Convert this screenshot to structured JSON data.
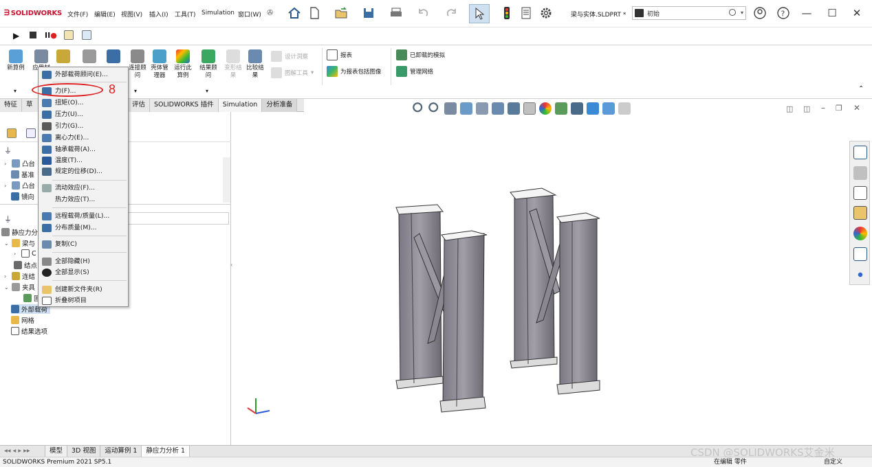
{
  "app": {
    "brand": "SOLIDWORKS",
    "doc_title": "梁与实体.SLDPRT *",
    "search_placeholder": "初始"
  },
  "menubar": [
    "文件(F)",
    "编辑(E)",
    "视图(V)",
    "插入(I)",
    "工具(T)",
    "Simulation",
    "窗口(W)"
  ],
  "ribbon": {
    "big": [
      {
        "label": "新算例",
        "icon": "new-study-icon"
      },
      {
        "label": "应用材",
        "icon": "apply-material-icon"
      },
      {
        "label": "结果顾\n问",
        "icon": "results-advisor-icon"
      },
      {
        "label": "变形结\n果",
        "icon": "deformed-result-icon",
        "disabled": true
      },
      {
        "label": "比较结\n果",
        "icon": "compare-results-icon"
      },
      {
        "label": "连接顾\n问",
        "icon": "connections-advisor-icon"
      },
      {
        "label": "壳体管\n理器",
        "icon": "shell-manager-icon"
      },
      {
        "label": "运行此\n算例",
        "icon": "run-study-icon"
      }
    ],
    "small": [
      "设计洞察",
      "图解工具",
      "报表",
      "为报表包括图像",
      "已卸载的模拟",
      "管理网络"
    ],
    "partial": [
      "传",
      "夹具顾",
      "外部载",
      "荷"
    ]
  },
  "tabs": [
    "特征",
    "草",
    "",
    "",
    "评估",
    "SOLIDWORKS 插件",
    "Simulation",
    "分析准备"
  ],
  "context_menu": {
    "items": [
      {
        "label": "外部载荷顾问(E)...",
        "icon": "load-advisor-icon"
      },
      {
        "label": "力(F)...",
        "icon": "force-icon"
      },
      {
        "label": "扭矩(O)...",
        "icon": "torque-icon"
      },
      {
        "label": "压力(U)...",
        "icon": "pressure-icon"
      },
      {
        "label": "引力(G)...",
        "icon": "gravity-icon"
      },
      {
        "label": "离心力(E)...",
        "icon": "centrifugal-icon"
      },
      {
        "label": "轴承载荷(A)...",
        "icon": "bearing-load-icon"
      },
      {
        "label": "温度(T)...",
        "icon": "temperature-icon"
      },
      {
        "label": "规定的位移(D)...",
        "icon": "displacement-icon"
      },
      {
        "label": "流动效应(F)...",
        "icon": "flow-icon"
      },
      {
        "label": "热力效应(T)...",
        "icon": "thermal-icon"
      },
      {
        "label": "远程载荷/质量(L)...",
        "icon": "remote-load-icon"
      },
      {
        "label": "分布质量(M)...",
        "icon": "distributed-mass-icon"
      },
      {
        "label": "复制(C)",
        "icon": "copy-icon"
      },
      {
        "label": "全部隐藏(H)",
        "icon": "hide-all-icon"
      },
      {
        "label": "全部显示(S)",
        "icon": "show-all-icon"
      },
      {
        "label": "创建新文件夹(R)",
        "icon": "new-folder-icon"
      },
      {
        "label": "折叠树项目",
        "icon": "collapse-tree-icon"
      }
    ],
    "annotation_number": "8"
  },
  "feature_tree": {
    "top": [
      "凸台",
      "基准",
      "凸台",
      "镜向"
    ],
    "study": [
      "静应力分",
      "梁与",
      "C",
      "结点",
      "连结",
      "夹具",
      "固",
      "外部载荷",
      "网格",
      "结果选项"
    ]
  },
  "bottom_tabs": [
    "模型",
    "3D 视图",
    "运动算例 1",
    "静应力分析 1"
  ],
  "status": {
    "left": "SOLIDWORKS Premium 2021 SP5.1",
    "right": "在编辑 零件",
    "right2": "自定义"
  },
  "watermark": "CSDN @SOLIDWORKS艾金米",
  "colors": {
    "accent": "#c8102e",
    "annotation": "#e02020",
    "beam": "#8d8a93"
  }
}
